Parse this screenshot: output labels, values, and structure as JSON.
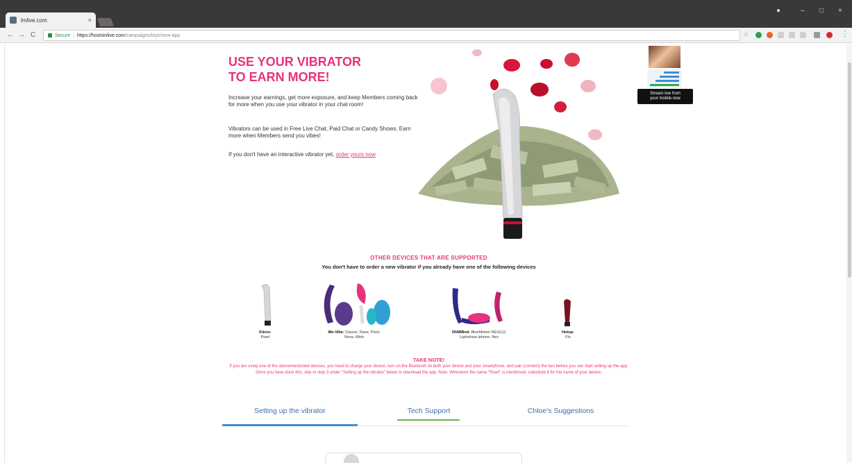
{
  "browser": {
    "tab_title": "lmlive.com",
    "tab_close": "×",
    "secure_label": "Secure",
    "url_host": "https://hostsinlive.com",
    "url_path": "/campaigns/toys/new-app",
    "window_controls": [
      "–",
      "□",
      "×"
    ],
    "nav_back": "←",
    "nav_forward": "→",
    "nav_reload": "C"
  },
  "hero": {
    "title_line1": "USE YOUR VIBRATOR",
    "title_line2": "TO EARN MORE!",
    "paragraph1": "Increase your earnings, get more exposure, and keep Members coming back for more when you use your vibrator in your chat room!",
    "paragraph2": "Vibrators can be used in Free Live Chat, Paid Chat or Candy Shows. Earn more when Members send you vibes!",
    "paragraph3": "If you don't have an interactive vibrator yet,",
    "order_link": "order yours now"
  },
  "widget": {
    "tooltip_line1": "Stream live from",
    "tooltip_line2": "your mobile now"
  },
  "devices": {
    "title": "OTHER DEVICES THAT ARE SUPPORTED",
    "subtitle": "You don't have to order a new vibrator if you already have one of the following devices",
    "items": [
      {
        "brand": "Kiiroo:",
        "models": "Pearl"
      },
      {
        "brand": "We-Vibe:",
        "models": "Classic, Rave, Pivot, Nova, Wish"
      },
      {
        "brand": "OhMiBod:",
        "models": "BlueMotion NEX|1|2, Lightshow Iphone, Nex"
      },
      {
        "brand": "Hotop:",
        "models": "Flo"
      }
    ]
  },
  "note": {
    "title": "TAKE NOTE!",
    "body": "If you are using one of the abovementioned devices, you need to charge your device, turn on the Bluetooth on both your device and your smartphone, and pair (connect) the two before you can start setting up the app. Once you have done this, skip to step 3 under \"Setting up the vibrator\" below to download the app. Note: Whenever the name \"Pearl\" is mentioned, substitute it for the name of your device."
  },
  "tabs": [
    {
      "label": "Setting up the vibrator"
    },
    {
      "label": "Tech Support"
    },
    {
      "label": "Chloe's Suggestions"
    }
  ],
  "colors": {
    "accent_pink": "#e8327b",
    "tab_blue": "#3b8fd6",
    "tab_green": "#6ab04c"
  }
}
